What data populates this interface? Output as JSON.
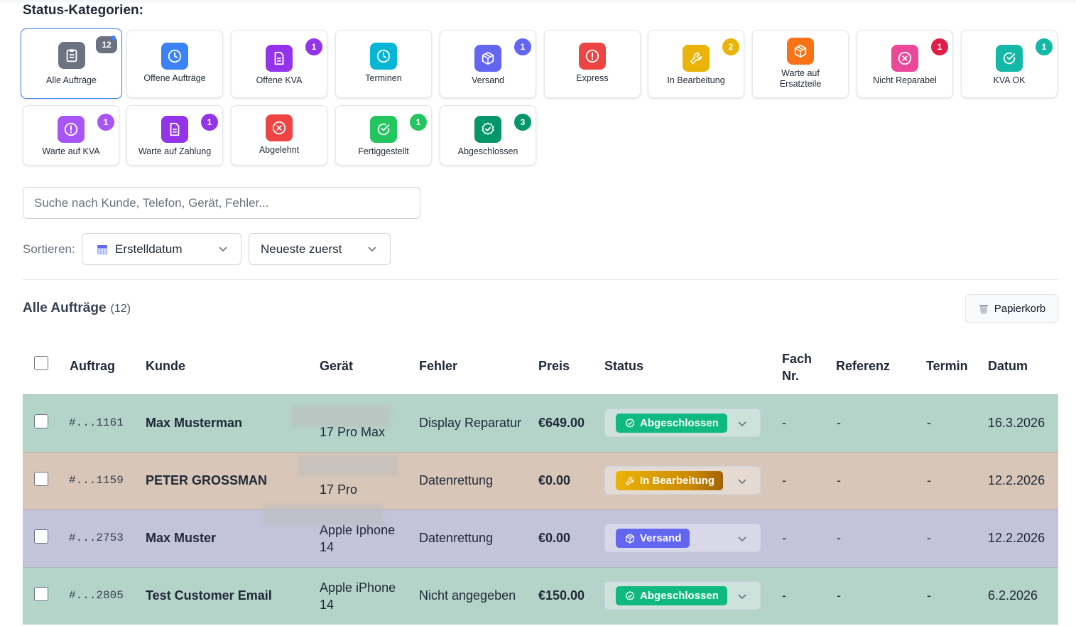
{
  "header": {
    "title": "Status-Kategorien:"
  },
  "categories": [
    {
      "label": "Alle Aufträge",
      "badge": "12",
      "icon": "clipboard-icon",
      "icon_color": "#6b7280",
      "badge_color": "#6b7280"
    },
    {
      "label": "Offene Aufträge",
      "badge": "",
      "icon": "clock-icon",
      "icon_color": "#3b82f6"
    },
    {
      "label": "Offene KVA",
      "badge": "1",
      "icon": "document-icon",
      "icon_color": "#9333ea",
      "badge_color": "#9333ea"
    },
    {
      "label": "Terminen",
      "badge": "",
      "icon": "clock-icon",
      "icon_color": "#06b6d4"
    },
    {
      "label": "Versand",
      "badge": "1",
      "icon": "package-icon",
      "icon_color": "#6366f1",
      "badge_color": "#6366f1"
    },
    {
      "label": "Express",
      "badge": "",
      "icon": "alert-icon",
      "icon_color": "#ef4444"
    },
    {
      "label": "In Bearbeitung",
      "badge": "2",
      "icon": "wrench-icon",
      "icon_color": "#eab308",
      "badge_color": "#eab308"
    },
    {
      "label": "Warte auf Ersatzteile",
      "badge": "",
      "icon": "package-icon",
      "icon_color": "#f97316"
    },
    {
      "label": "Nicht Reparabel",
      "badge": "1",
      "icon": "x-circle-icon",
      "icon_color": "#ec4899",
      "badge_color": "#e11d48"
    },
    {
      "label": "KVA OK",
      "badge": "1",
      "icon": "check-circle-icon",
      "icon_color": "#14b8a6",
      "badge_color": "#14b8a6"
    },
    {
      "label": "Warte auf KVA",
      "badge": "1",
      "icon": "alert-icon",
      "icon_color": "#a855f7",
      "badge_color": "#a855f7"
    },
    {
      "label": "Warte auf Zahlung",
      "badge": "1",
      "icon": "document-icon",
      "icon_color": "#9333ea",
      "badge_color": "#9333ea"
    },
    {
      "label": "Abgelehnt",
      "badge": "",
      "icon": "x-circle-icon",
      "icon_color": "#ef4444"
    },
    {
      "label": "Fertiggestellt",
      "badge": "1",
      "icon": "check-circle-icon",
      "icon_color": "#22c55e",
      "badge_color": "#22c55e"
    },
    {
      "label": "Abgeschlossen",
      "badge": "3",
      "icon": "check-badge-icon",
      "icon_color": "#059669",
      "badge_color": "#059669"
    }
  ],
  "search": {
    "placeholder": "Suche nach Kunde, Telefon, Gerät, Fehler..."
  },
  "sort": {
    "label": "Sortieren:",
    "field": "Erstelldatum",
    "order": "Neueste zuerst"
  },
  "list": {
    "title": "Alle Aufträge",
    "count": "(12)",
    "trash_label": "Papierkorb"
  },
  "table": {
    "headers": {
      "order": "Auftrag",
      "customer": "Kunde",
      "device": "Gerät",
      "fault": "Fehler",
      "price": "Preis",
      "status": "Status",
      "fach_1": "Fach",
      "fach_2": "Nr.",
      "reference": "Referenz",
      "appointment": "Termin",
      "date": "Datum"
    },
    "rows": [
      {
        "order": "#...1161",
        "customer": "Max Musterman",
        "device_line1": "",
        "device_line2": "17 Pro Max",
        "fault": "Display Reparatur",
        "price": "€649.00",
        "status": "Abgeschlossen",
        "status_color": "#10b981",
        "status_icon": "check-badge-icon",
        "fach": "-",
        "reference": "-",
        "appointment": "-",
        "date": "16.3.2026",
        "row_color": "#b4d3c9"
      },
      {
        "order": "#...1159",
        "customer": "PETER GROSSMAN",
        "device_line1": "",
        "device_line2": "17 Pro",
        "fault": "Datenrettung",
        "price": "€0.00",
        "status": "In Bearbeitung",
        "status_color": "#eab308",
        "status_icon": "wrench-icon",
        "fach": "-",
        "reference": "-",
        "appointment": "-",
        "date": "12.2.2026",
        "row_color": "#d8c6b8"
      },
      {
        "order": "#...2753",
        "customer": "Max Muster",
        "device_line1": "Apple Iphone",
        "device_line2": "14",
        "fault": "Datenrettung",
        "price": "€0.00",
        "status": "Versand",
        "status_color": "#6366f1",
        "status_icon": "package-icon",
        "fach": "-",
        "reference": "-",
        "appointment": "-",
        "date": "12.2.2026",
        "row_color": "#c3c3dc"
      },
      {
        "order": "#...2805",
        "customer": "Test Customer Email",
        "device_line1": "Apple iPhone",
        "device_line2": "14",
        "fault": "Nicht angegeben",
        "price": "€150.00",
        "status": "Abgeschlossen",
        "status_color": "#10b981",
        "status_icon": "check-badge-icon",
        "fach": "-",
        "reference": "-",
        "appointment": "-",
        "date": "6.2.2026",
        "row_color": "#b4d3c9"
      }
    ]
  }
}
